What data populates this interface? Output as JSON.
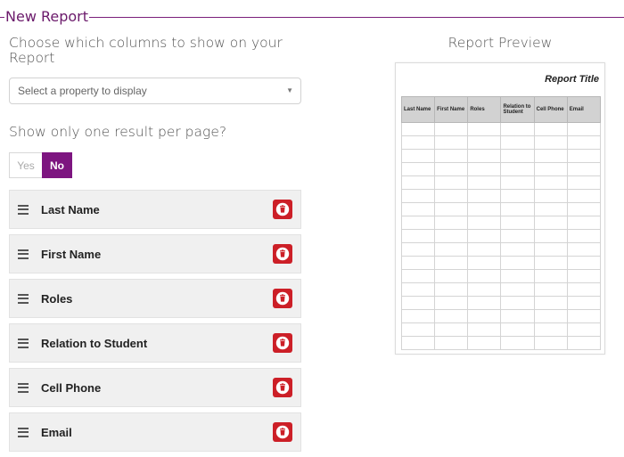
{
  "legend": "New Report",
  "columns_section": {
    "heading": "Choose which columns to show on your Report",
    "select_placeholder": "Select a property to display"
  },
  "one_per_page": {
    "question": "Show only one result per page?",
    "yes_label": "Yes",
    "no_label": "No",
    "selected": "No"
  },
  "selected_columns": [
    {
      "label": "Last Name"
    },
    {
      "label": "First Name"
    },
    {
      "label": "Roles"
    },
    {
      "label": "Relation to Student"
    },
    {
      "label": "Cell Phone"
    },
    {
      "label": "Email"
    }
  ],
  "preview": {
    "heading": "Report Preview",
    "report_title": "Report Title",
    "headers": [
      "Last Name",
      "First Name",
      "Roles",
      "Relation to Student",
      "Cell Phone",
      "Email"
    ],
    "empty_row_count": 17
  },
  "colors": {
    "accent": "#7d1580",
    "delete": "#cc1f27"
  }
}
